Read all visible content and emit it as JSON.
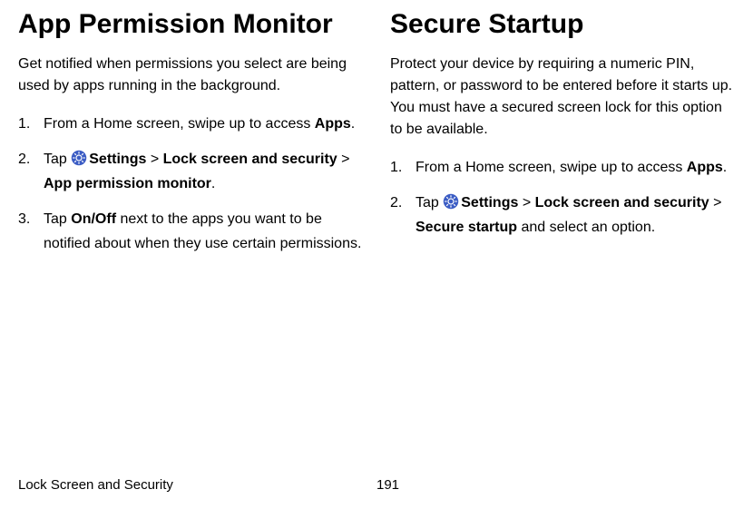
{
  "left": {
    "heading": "App Permission Monitor",
    "intro": "Get notified when permissions you select are being used by apps running in the background.",
    "steps": {
      "s1_a": "From a Home screen, swipe up to access ",
      "s1_b": "Apps",
      "s1_c": ".",
      "s2_a": "Tap ",
      "s2_settings": "Settings",
      "s2_sep1": " > ",
      "s2_lock": "Lock screen and security",
      "s2_sep2": " > ",
      "s2_apm": "App permission monitor",
      "s2_end": ".",
      "s3_a": "Tap ",
      "s3_onoff": "On/Off",
      "s3_b": " next to the apps you want to be notified about when they use certain permissions."
    }
  },
  "right": {
    "heading": "Secure Startup",
    "intro": "Protect your device by requiring a numeric PIN, pattern, or password to be entered before it starts up. You must have a secured screen lock for this option to be available.",
    "steps": {
      "s1_a": "From a Home screen, swipe up to access ",
      "s1_b": "Apps",
      "s1_c": ".",
      "s2_a": "Tap ",
      "s2_settings": "Settings",
      "s2_sep1": " > ",
      "s2_lock": "Lock screen and security",
      "s2_sep2": " > ",
      "s2_secure": "Secure startup",
      "s2_end": " and select an option."
    }
  },
  "footer": {
    "section": "Lock Screen and Security",
    "page": "191"
  }
}
